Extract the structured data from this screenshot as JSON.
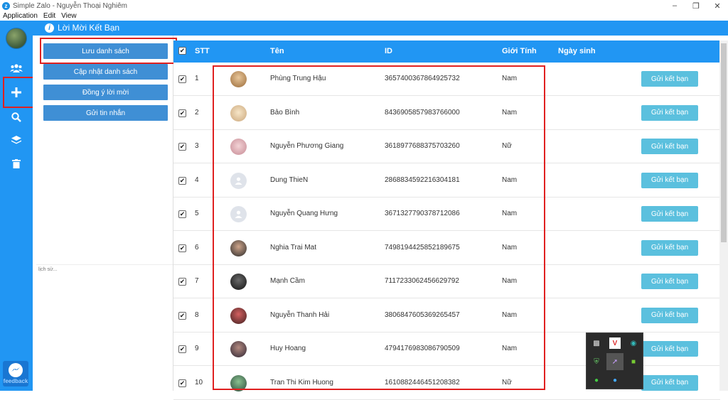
{
  "window": {
    "title": "Simple Zalo - Nguyễn Thoại Nghiêm",
    "menu": [
      "Application",
      "Edit",
      "View"
    ]
  },
  "page": {
    "title": "Lời Mời Kết Bạn"
  },
  "sidebar": {
    "icons": [
      "users-icon",
      "plus-icon",
      "search-icon",
      "layers-icon",
      "trash-icon"
    ],
    "feedback_label": "feedback"
  },
  "actions": {
    "save_list": "Lưu danh sách",
    "update_list": "Cập nhật danh sách",
    "accept_invites": "Đồng ý lời mời",
    "send_message": "Gửi tin nhắn",
    "history_placeholder": "lịch sử..."
  },
  "table": {
    "headers": {
      "stt": "STT",
      "name": "Tên",
      "id": "ID",
      "gender": "Giới Tính",
      "birthday": "Ngày sinh"
    },
    "send_label": "Gửi kết bạn",
    "rows": [
      {
        "stt": "1",
        "name": "Phùng Trung Hậu",
        "id": "3657400367864925732",
        "gender": "Nam",
        "birthday": ""
      },
      {
        "stt": "2",
        "name": "Bảo Bình",
        "id": "8436905857983766000",
        "gender": "Nam",
        "birthday": ""
      },
      {
        "stt": "3",
        "name": "Nguyễn Phương Giang",
        "id": "3618977688375703260",
        "gender": "Nữ",
        "birthday": ""
      },
      {
        "stt": "4",
        "name": "Dung ThieN",
        "id": "2868834592216304181",
        "gender": "Nam",
        "birthday": ""
      },
      {
        "stt": "5",
        "name": "Nguyễn Quang Hưng",
        "id": "3671327790378712086",
        "gender": "Nam",
        "birthday": ""
      },
      {
        "stt": "6",
        "name": "Nghia Trai Mat",
        "id": "7498194425852189675",
        "gender": "Nam",
        "birthday": ""
      },
      {
        "stt": "7",
        "name": "Mạnh Cầm",
        "id": "7117233062456629792",
        "gender": "Nam",
        "birthday": ""
      },
      {
        "stt": "8",
        "name": "Nguyễn Thanh Hải",
        "id": "3806847605369265457",
        "gender": "Nam",
        "birthday": ""
      },
      {
        "stt": "9",
        "name": "Huy Hoang",
        "id": "4794176983086790509",
        "gender": "Nam",
        "birthday": ""
      },
      {
        "stt": "10",
        "name": "Tran Thi Kim Huong",
        "id": "1610882446451208382",
        "gender": "Nữ",
        "birthday": ""
      }
    ]
  },
  "colors": {
    "accent": "#2196f3",
    "button": "#3f8fd5",
    "send": "#5bc0de",
    "highlight": "#e02020"
  }
}
